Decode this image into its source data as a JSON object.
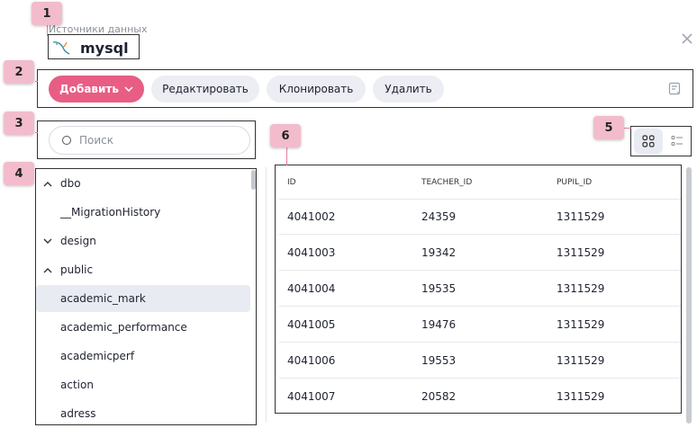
{
  "header": {
    "breadcrumb": "Источники данных",
    "title": "mysql",
    "db_icon": "mysql-dolphin-icon",
    "close_icon": "close-icon"
  },
  "toolbar": {
    "add_label": "Добавить",
    "edit_label": "Редактировать",
    "clone_label": "Клонировать",
    "delete_label": "Удалить",
    "query_icon": "sql-editor-icon"
  },
  "search": {
    "placeholder": "Поиск",
    "value": ""
  },
  "tree": {
    "items": [
      {
        "label": "dbo",
        "chevron": "up"
      },
      {
        "label": "__MigrationHistory",
        "chevron": ""
      },
      {
        "label": "design",
        "chevron": "down"
      },
      {
        "label": "public",
        "chevron": "up"
      },
      {
        "label": "academic_mark",
        "chevron": "",
        "selected": true
      },
      {
        "label": "academic_performance",
        "chevron": ""
      },
      {
        "label": "academicperf",
        "chevron": ""
      },
      {
        "label": "action",
        "chevron": ""
      },
      {
        "label": "adress",
        "chevron": ""
      }
    ]
  },
  "view_toggle": {
    "active": "grid-view",
    "icons": [
      "grid-view-icon",
      "list-view-icon"
    ]
  },
  "table": {
    "columns": [
      "ID",
      "TEACHER_ID",
      "PUPIL_ID"
    ],
    "rows": [
      [
        "4041002",
        "24359",
        "1311529"
      ],
      [
        "4041003",
        "19342",
        "1311529"
      ],
      [
        "4041004",
        "19535",
        "1311529"
      ],
      [
        "4041005",
        "19476",
        "1311529"
      ],
      [
        "4041006",
        "19553",
        "1311529"
      ],
      [
        "4041007",
        "20582",
        "1311529"
      ]
    ]
  },
  "annotations": {
    "markers": [
      "1",
      "2",
      "3",
      "4",
      "5",
      "6"
    ]
  },
  "colors": {
    "accent": "#e85d84",
    "marker": "#f2bccd",
    "marker_border": "#e2809d",
    "selected_bg": "#e9ebf3"
  }
}
